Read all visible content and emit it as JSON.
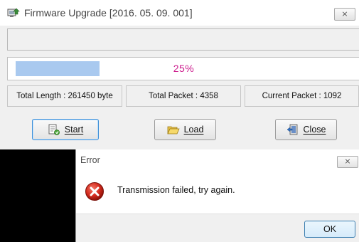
{
  "main_window": {
    "title": "Firmware Upgrade [2016. 05. 09. 001]",
    "title_icon": "firmware-upgrade-icon",
    "close_glyph": "⨯",
    "progress": {
      "fraction": 0.25,
      "text": "25%",
      "fill_color": "#a9c9ef",
      "text_color": "#cc1a8c"
    },
    "info": {
      "total_length": "Total Length : 261450 byte",
      "total_packet": "Total Packet : 4358",
      "current_packet": "Current Packet : 1092"
    },
    "buttons": {
      "start": {
        "label": "Start",
        "icon": "start-icon"
      },
      "load": {
        "label": "Load",
        "icon": "folder-open-icon"
      },
      "close": {
        "label": "Close",
        "icon": "exit-door-icon"
      }
    }
  },
  "error_dialog": {
    "title": "Error",
    "close_glyph": "⨯",
    "icon": "error-icon",
    "message": "Transmission failed, try again.",
    "ok_label": "OK"
  }
}
